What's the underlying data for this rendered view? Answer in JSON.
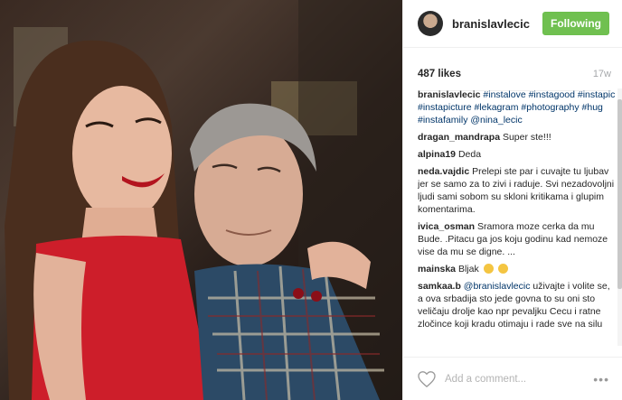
{
  "header": {
    "username": "branislavlecic",
    "follow_label": "Following"
  },
  "stats": {
    "likes": "487 likes",
    "age": "17w"
  },
  "caption": {
    "user": "branislavlecic",
    "text": "#instalove #instagood #instapic #instapicture #lekagram #photography #hug #instafamily @nina_lecic"
  },
  "comments": [
    {
      "user": "dragan_mandrapa",
      "text": "Super ste!!!"
    },
    {
      "user": "alpina19",
      "text": "Deda"
    },
    {
      "user": "neda.vajdic",
      "text": "Prelepi ste par i cuvajte tu ljubav jer se samo za to zivi i raduje. Svi nezadovoljni ljudi sami sobom su skloni kritikama i glupim komentarima."
    },
    {
      "user": "ivica_osman",
      "text": "Sramora moze cerka da mu Bude. .Pitacu ga jos koju godinu kad nemoze vise da mu se digne. ..."
    },
    {
      "user": "mainska",
      "text": "Bljak"
    },
    {
      "user": "samkaa.b",
      "mention": "@branislavlecic",
      "text": "uživajte i volite se, a ova srbadija sto jede govna to su oni sto veličaju drolje kao npr pevaljku Cecu i ratne zločince koji kradu otimaju i rade sve na silu"
    }
  ],
  "footer": {
    "placeholder": "Add a comment...",
    "more_icon": "•••"
  },
  "colors": {
    "follow": "#70c050",
    "link": "#003569",
    "bg": "#ffffff"
  }
}
